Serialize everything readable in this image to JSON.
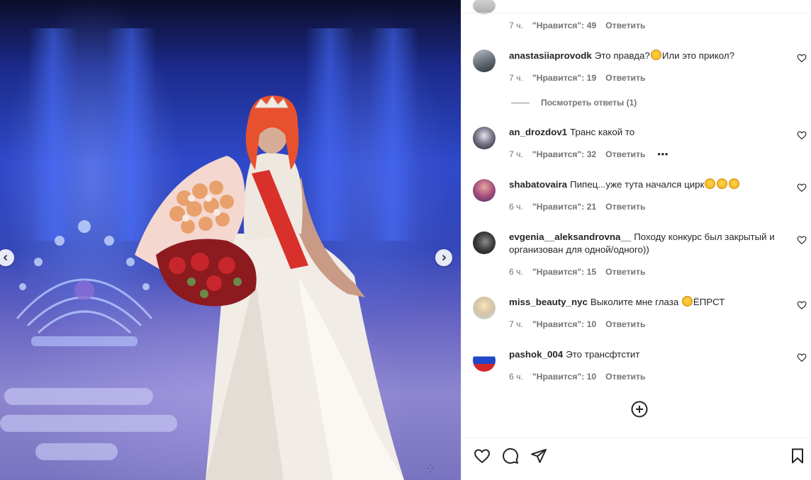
{
  "photo": {
    "prev_icon": "chevron-left-icon",
    "next_icon": "chevron-right-icon"
  },
  "comments": [
    {
      "username": "",
      "text": "",
      "time": "7 ч.",
      "likes": "\"Нравится\": 49",
      "reply": "Ответить"
    },
    {
      "username": "anastasiiaprovodk",
      "text": "Это правда?",
      "text2": "Или это прикол?",
      "time": "7 ч.",
      "likes": "\"Нравится\": 19",
      "reply": "Ответить",
      "view_replies": "Посмотреть ответы (1)"
    },
    {
      "username": "an_drozdov1",
      "text": "Транс какой то",
      "time": "7 ч.",
      "likes": "\"Нравится\": 32",
      "reply": "Ответить",
      "more": "•••"
    },
    {
      "username": "shabatovaira",
      "text": "Пипец...уже тута начался цирк",
      "time": "6 ч.",
      "likes": "\"Нравится\": 21",
      "reply": "Ответить"
    },
    {
      "username": "evgenia__aleksandrovna__",
      "text": "Походу конкурс был закрытый и организован для одной/одного))",
      "time": "6 ч.",
      "likes": "\"Нравится\": 15",
      "reply": "Ответить"
    },
    {
      "username": "miss_beauty_nyc",
      "text": "Выколите мне глаза",
      "text2": "ЁПРСТ",
      "time": "7 ч.",
      "likes": "\"Нравится\": 10",
      "reply": "Ответить"
    },
    {
      "username": "pashok_004",
      "text": "Это трансфтстит",
      "time": "6 ч.",
      "likes": "\"Нравится\": 10",
      "reply": "Ответить"
    }
  ],
  "icons": {
    "comment_like": "heart-outline-icon",
    "load_more": "plus-circle-icon",
    "like": "heart-icon",
    "comment": "comment-bubble-icon",
    "share": "paper-plane-icon",
    "save": "bookmark-icon"
  },
  "colors": {
    "text": "#262626",
    "secondary": "#737373",
    "divider": "#efefef"
  }
}
